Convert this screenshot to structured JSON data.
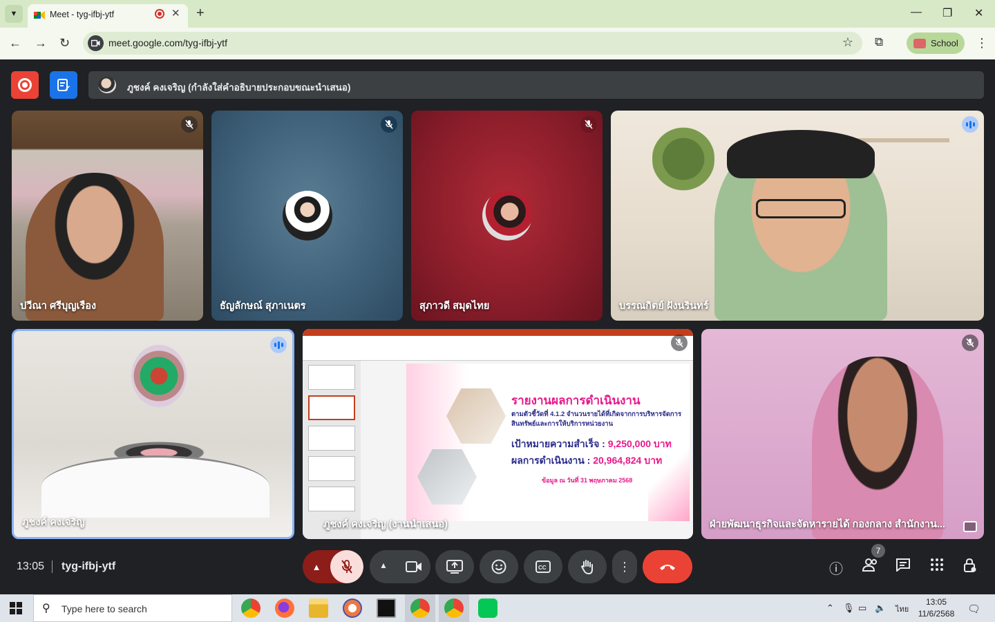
{
  "browser": {
    "tab_title": "Meet - tyg-ifbj-ytf",
    "url": "meet.google.com/tyg-ifbj-ytf",
    "profile_label": "School"
  },
  "meet": {
    "presenting_banner": "ภูชงค์ คงเจริญ (กำลังใส่คำอธิบายประกอบขณะนำเสนอ)",
    "tiles": [
      {
        "name": "ปวีณา ศรีบุญเรือง",
        "mic": "muted"
      },
      {
        "name": "ธัญลักษณ์ สุภาเนตร",
        "mic": "muted"
      },
      {
        "name": "สุภาวดี สมุดไทย",
        "mic": "muted"
      },
      {
        "name": "บรรณกิตย์ ฝังนรินทร์",
        "mic": "speaking"
      },
      {
        "name": "ภูชงค์ คงเจริญ",
        "mic": "speaking"
      },
      {
        "name": "ภูชงค์ คงเจริญ (งานนำเสนอ)",
        "mic": "muted"
      },
      {
        "name": "ฝ่ายพัฒนาธุรกิจและจัดหารายได้ กองกลาง สำนักงาน...",
        "mic": "muted"
      }
    ],
    "slide": {
      "title": "รายงานผลการดำเนินงาน",
      "subtitle": "ตามตัวชี้วัดที่ 4.1.2 จำนวนรายได้ที่เกิดจากการบริหารจัดการสินทรัพย์และการให้บริการหน่วยงาน",
      "goal_label": "เป้าหมายความสำเร็จ :",
      "goal_value": "9,250,000 บาท",
      "result_label": "ผลการดำเนินงาน :",
      "result_value": "20,964,824 บาท",
      "date_note": "ข้อมูล ณ วันที่ 31 พฤษภาคม 2568"
    },
    "clock": "13:05",
    "meeting_code": "tyg-ifbj-ytf",
    "participant_count": "7"
  },
  "taskbar": {
    "search_placeholder": "Type here to search",
    "language": "ไทย",
    "time": "13:05",
    "date": "11/6/2568"
  },
  "colors": {
    "accent_red": "#ea4335",
    "accent_blue": "#1a73e8",
    "slide_pink": "#e8188a",
    "slide_navy": "#2b2b8a"
  }
}
